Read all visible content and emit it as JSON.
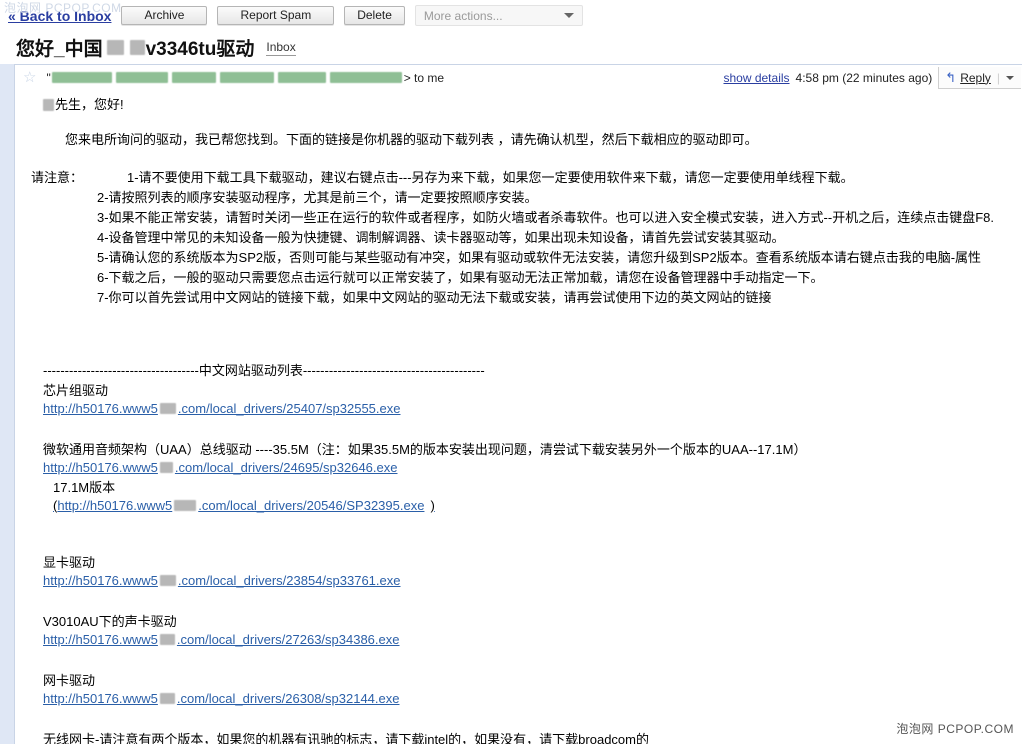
{
  "watermark": {
    "top": "泡泡网  PCPOP.COM",
    "bottom": "泡泡网 PCPOP.COM"
  },
  "toolbar": {
    "back_to_inbox": "« Back to Inbox",
    "archive": "Archive",
    "report_spam": "Report Spam",
    "delete": "Delete",
    "more_actions": "More actions...",
    "caret_icon": "chevron-down-icon"
  },
  "subject": {
    "text_before": "您好_中国",
    "text_after": "v3346tu驱动",
    "label": "Inbox"
  },
  "message_header": {
    "star_icon": "star-icon",
    "quote_open": "\"",
    "to_me": "> to me",
    "show_details": "show details",
    "timestamp": "4:58 pm (22 minutes ago)",
    "reply_arrow_icon": "reply-arrow-icon",
    "reply_label": "Reply",
    "reply_caret_icon": "chevron-down-icon"
  },
  "body": {
    "greeting": "先生，您好!",
    "intro": "您来电所询问的驱动，我已帮您找到。下面的链接是你机器的驱动下载列表 ，请先确认机型，然后下载相应的驱动即可。",
    "notice_label": "请注意：",
    "notices": [
      "1-请不要使用下载工具下载驱动，建议右键点击---另存为来下载，如果您一定要使用软件来下载，请您一定要使用单线程下载。",
      "2-请按照列表的顺序安装驱动程序，尤其是前三个，请一定要按照顺序安装。",
      "3-如果不能正常安装，请暂时关闭一些正在运行的软件或者程序，如防火墙或者杀毒软件。也可以进入安全模式安装，进入方式--开机之后，连续点击键盘F8.",
      "4-设备管理中常见的未知设备一般为快捷键、调制解调器、读卡器驱动等，如果出现未知设备，请首先尝试安装其驱动。",
      "5-请确认您的系统版本为SP2版，否则可能与某些驱动有冲突，如果有驱动或软件无法安装，请您升级到SP2版本。查看系统版本请右键点击我的电脑-属性",
      "6-下载之后，一般的驱动只需要您点击运行就可以正常安装了，如果有驱动无法正常加载，请您在设备管理器中手动指定一下。",
      "7-你可以首先尝试用中文网站的链接下载，如果中文网站的驱动无法下载或安装，请再尝试使用下边的英文网站的链接"
    ],
    "divider": "------------------------------------中文网站驱动列表------------------------------------------",
    "sections": [
      {
        "title": "芯片组驱动",
        "link_prefix": "http://h50176.www5",
        "link_suffix": ".com/local_drivers/25407/sp32555.exe"
      },
      {
        "title": "显卡驱动",
        "link_prefix": "http://h50176.www5",
        "link_suffix": ".com/local_drivers/23854/sp33761.exe"
      },
      {
        "title": "V3010AU下的声卡驱动",
        "link_prefix": "http://h50176.www5",
        "link_suffix": ".com/local_drivers/27263/sp34386.exe"
      },
      {
        "title": "网卡驱动",
        "link_prefix": "http://h50176.www5",
        "link_suffix": ".com/local_drivers/26308/sp32144.exe"
      }
    ],
    "uaa": {
      "note": "微软通用音频架构（UAA）总线驱动  ----35.5M（注：如果35.5M的版本安装出现问题，清尝试下载安装另外一个版本的UAA--17.1M）",
      "link_prefix": "http://h50176.www5",
      "link_suffix": ".com/local_drivers/24695/sp32646.exe",
      "alt_version_label": "17.1M版本",
      "alt_open_paren": "(",
      "alt_link_prefix": "http://h50176.www5",
      "alt_link_suffix": ".com/local_drivers/20546/SP32395.exe",
      "alt_close_paren": ")"
    },
    "last_line": "无线网卡-请注意有两个版本，如果您的机器有讯驰的标志，请下载intel的，如果没有，请下载broadcom的"
  },
  "colors": {
    "page_bg": "#dfe7f5",
    "panel_bg": "#ffffff",
    "link": "#2a5fa8",
    "nav_link": "#2a3ea1",
    "redaction_gray": "#b7b7b7",
    "redaction_green": "#8fbf95"
  }
}
